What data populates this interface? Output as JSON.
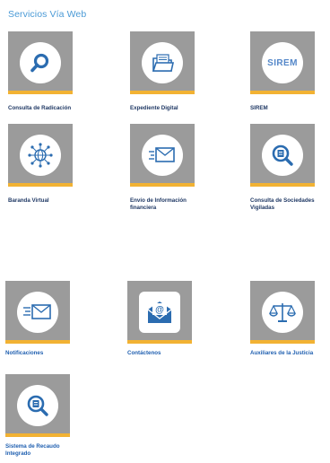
{
  "section": {
    "title": "Servicios Vía Web"
  },
  "colors": {
    "tile_bg": "#9b9b9b",
    "accent_bar": "#f2b233",
    "icon_blue": "#2b6cb0",
    "title_blue": "#4a9ad6"
  },
  "tiles": [
    {
      "label": "Consulta de Radicación",
      "icon": "search-icon"
    },
    {
      "label": "Expediente Digital",
      "icon": "folder-icon"
    },
    {
      "label": "SIREM",
      "icon": "sirem-text-icon",
      "icon_text": "SIREM"
    },
    {
      "label": "Baranda Virtual",
      "icon": "globe-network-icon"
    },
    {
      "label": "Envío de Información financiera",
      "icon": "envelope-icon"
    },
    {
      "label": "Consulta de Sociedades Vigiladas",
      "icon": "company-search-icon"
    },
    {
      "label": "Notificaciones",
      "icon": "fast-envelope-icon"
    },
    {
      "label": "Contáctenos",
      "icon": "email-at-icon"
    },
    {
      "label": "Auxiliares de la Justicia",
      "icon": "scales-icon"
    },
    {
      "label": "Sistema de Recaudo Integrado",
      "icon": "money-search-icon"
    }
  ]
}
